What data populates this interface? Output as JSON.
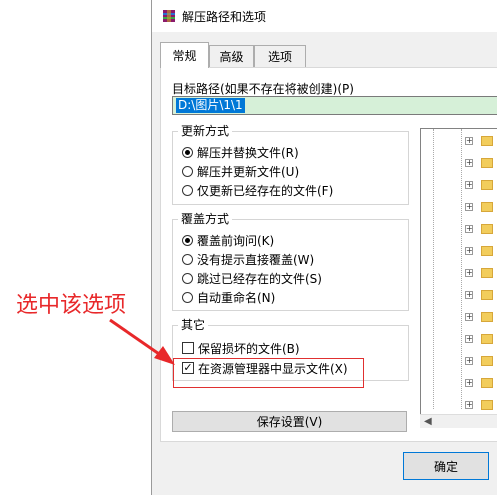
{
  "window": {
    "title": "解压路径和选项"
  },
  "tabs": [
    {
      "label": "常规",
      "active": true
    },
    {
      "label": "高级",
      "active": false
    },
    {
      "label": "选项",
      "active": false
    }
  ],
  "destination": {
    "label": "目标路径(如果不存在将被创建)(P)",
    "value": "D:\\图片\\1\\1"
  },
  "update_mode": {
    "title": "更新方式",
    "options": [
      {
        "label": "解压并替换文件(R)",
        "selected": true
      },
      {
        "label": "解压并更新文件(U)",
        "selected": false
      },
      {
        "label": "仅更新已经存在的文件(F)",
        "selected": false
      }
    ]
  },
  "overwrite_mode": {
    "title": "覆盖方式",
    "options": [
      {
        "label": "覆盖前询问(K)",
        "selected": true
      },
      {
        "label": "没有提示直接覆盖(W)",
        "selected": false
      },
      {
        "label": "跳过已经存在的文件(S)",
        "selected": false
      },
      {
        "label": "自动重命名(N)",
        "selected": false
      }
    ]
  },
  "misc": {
    "title": "其它",
    "options": [
      {
        "label": "保留损坏的文件(B)",
        "checked": false
      },
      {
        "label": "在资源管理器中显示文件(X)",
        "checked": true
      }
    ]
  },
  "buttons": {
    "save": "保存设置(V)",
    "ok": "确定"
  },
  "annotation": {
    "text": "选中该选项",
    "color": "#e8282a"
  },
  "colors": {
    "path_bg": "#d6f0d8",
    "selection": "#0078d7",
    "highlight_box": "#e03030"
  }
}
